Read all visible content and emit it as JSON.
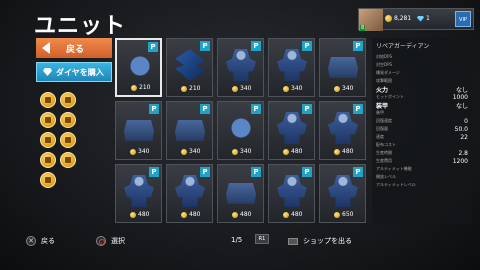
{
  "header": {
    "title": "ユニット"
  },
  "topbar": {
    "level": "8",
    "coins": "8,281",
    "gems": "1",
    "vip": "VIP"
  },
  "left": {
    "back_label": "戻る",
    "buy_label": "ダイヤを購入",
    "filters": [
      "helmet-icon",
      "tank-icon",
      "robot-icon",
      "wrench-icon",
      "drone-icon",
      "shield-icon",
      "aircraft-icon",
      "lab-icon",
      "star-icon"
    ]
  },
  "cards": [
    {
      "type": "drone",
      "price": "210",
      "selected": true
    },
    {
      "type": "axe",
      "price": "210"
    },
    {
      "type": "robot",
      "price": "340"
    },
    {
      "type": "robot",
      "price": "340"
    },
    {
      "type": "tank",
      "price": "340"
    },
    {
      "type": "tank",
      "price": "340"
    },
    {
      "type": "tank",
      "price": "340"
    },
    {
      "type": "drone",
      "price": "340"
    },
    {
      "type": "robot",
      "price": "480"
    },
    {
      "type": "robot",
      "price": "480"
    },
    {
      "type": "robot",
      "price": "480"
    },
    {
      "type": "robot",
      "price": "480"
    },
    {
      "type": "tank",
      "price": "480"
    },
    {
      "type": "robot",
      "price": "480"
    },
    {
      "type": "robot",
      "price": "650"
    }
  ],
  "info": {
    "name": "リペアガーディアン",
    "stats": [
      {
        "label": "対地DPS",
        "value": "",
        "big": false
      },
      {
        "label": "対空DPS",
        "value": "",
        "big": false
      },
      {
        "label": "爆発ダメージ",
        "value": "",
        "big": false
      },
      {
        "label": "攻撃範囲",
        "value": "",
        "big": false
      },
      {
        "label": "火力",
        "value": "なし",
        "big": true
      },
      {
        "label": "ヒットポイント",
        "value": "1000",
        "big": false
      },
      {
        "label": "装甲",
        "value": "なし",
        "big": true
      },
      {
        "label": "装甲",
        "value": "",
        "big": false
      },
      {
        "label": "回復速度",
        "value": "0",
        "big": false
      },
      {
        "label": "回復量",
        "value": "50.0",
        "big": false
      },
      {
        "label": "速度",
        "value": "22",
        "big": false
      },
      {
        "label": "配布コスト",
        "value": "",
        "big": false
      },
      {
        "label": "生産時間",
        "value": "2.8",
        "big": false
      },
      {
        "label": "生産費用",
        "value": "1200",
        "big": false
      },
      {
        "label": "アルティメット機能",
        "value": "",
        "big": false
      },
      {
        "label": "開放レベル",
        "value": "",
        "big": false
      },
      {
        "label": "アルティメットレベル",
        "value": "",
        "big": false
      }
    ]
  },
  "bottom": {
    "back_label": "戻る",
    "select_label": "選択",
    "page": "1/5",
    "r1": "R1",
    "exit_shop_label": "ショップを出る"
  }
}
